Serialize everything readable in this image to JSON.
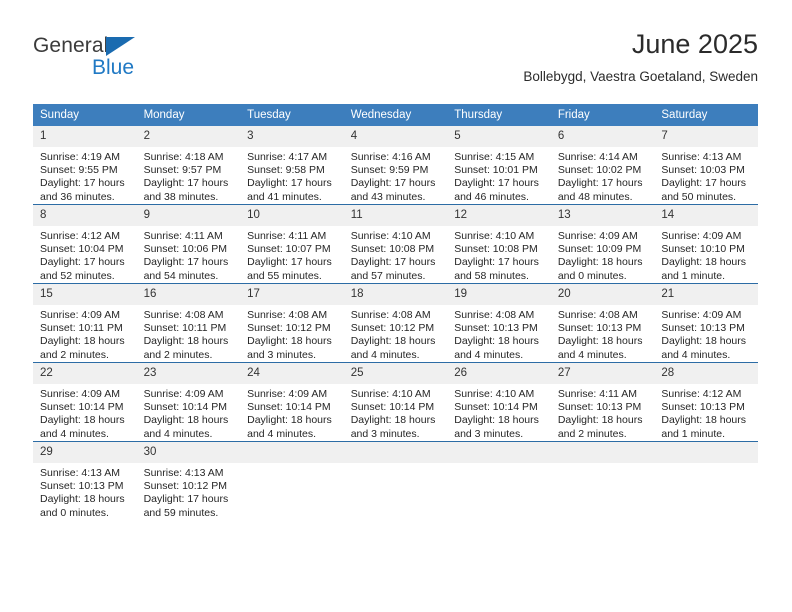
{
  "brand": {
    "name_top": "General",
    "name_bottom": "Blue",
    "accent_color": "#2079c4",
    "triangle_color": "#1a6bb0"
  },
  "header": {
    "title": "June 2025",
    "subtitle": "Bollebygd, Vaestra Goetaland, Sweden"
  },
  "theme": {
    "header_bg": "#3d7ebd",
    "row_divider": "#2c6ca5",
    "daynum_bg": "#f0f0f0"
  },
  "calendar": {
    "weekday_headers": [
      "Sunday",
      "Monday",
      "Tuesday",
      "Wednesday",
      "Thursday",
      "Friday",
      "Saturday"
    ],
    "weeks": [
      [
        {
          "day": "1",
          "sunrise": "Sunrise: 4:19 AM",
          "sunset": "Sunset: 9:55 PM",
          "daylight_line1": "Daylight: 17 hours",
          "daylight_line2": "and 36 minutes."
        },
        {
          "day": "2",
          "sunrise": "Sunrise: 4:18 AM",
          "sunset": "Sunset: 9:57 PM",
          "daylight_line1": "Daylight: 17 hours",
          "daylight_line2": "and 38 minutes."
        },
        {
          "day": "3",
          "sunrise": "Sunrise: 4:17 AM",
          "sunset": "Sunset: 9:58 PM",
          "daylight_line1": "Daylight: 17 hours",
          "daylight_line2": "and 41 minutes."
        },
        {
          "day": "4",
          "sunrise": "Sunrise: 4:16 AM",
          "sunset": "Sunset: 9:59 PM",
          "daylight_line1": "Daylight: 17 hours",
          "daylight_line2": "and 43 minutes."
        },
        {
          "day": "5",
          "sunrise": "Sunrise: 4:15 AM",
          "sunset": "Sunset: 10:01 PM",
          "daylight_line1": "Daylight: 17 hours",
          "daylight_line2": "and 46 minutes."
        },
        {
          "day": "6",
          "sunrise": "Sunrise: 4:14 AM",
          "sunset": "Sunset: 10:02 PM",
          "daylight_line1": "Daylight: 17 hours",
          "daylight_line2": "and 48 minutes."
        },
        {
          "day": "7",
          "sunrise": "Sunrise: 4:13 AM",
          "sunset": "Sunset: 10:03 PM",
          "daylight_line1": "Daylight: 17 hours",
          "daylight_line2": "and 50 minutes."
        }
      ],
      [
        {
          "day": "8",
          "sunrise": "Sunrise: 4:12 AM",
          "sunset": "Sunset: 10:04 PM",
          "daylight_line1": "Daylight: 17 hours",
          "daylight_line2": "and 52 minutes."
        },
        {
          "day": "9",
          "sunrise": "Sunrise: 4:11 AM",
          "sunset": "Sunset: 10:06 PM",
          "daylight_line1": "Daylight: 17 hours",
          "daylight_line2": "and 54 minutes."
        },
        {
          "day": "10",
          "sunrise": "Sunrise: 4:11 AM",
          "sunset": "Sunset: 10:07 PM",
          "daylight_line1": "Daylight: 17 hours",
          "daylight_line2": "and 55 minutes."
        },
        {
          "day": "11",
          "sunrise": "Sunrise: 4:10 AM",
          "sunset": "Sunset: 10:08 PM",
          "daylight_line1": "Daylight: 17 hours",
          "daylight_line2": "and 57 minutes."
        },
        {
          "day": "12",
          "sunrise": "Sunrise: 4:10 AM",
          "sunset": "Sunset: 10:08 PM",
          "daylight_line1": "Daylight: 17 hours",
          "daylight_line2": "and 58 minutes."
        },
        {
          "day": "13",
          "sunrise": "Sunrise: 4:09 AM",
          "sunset": "Sunset: 10:09 PM",
          "daylight_line1": "Daylight: 18 hours",
          "daylight_line2": "and 0 minutes."
        },
        {
          "day": "14",
          "sunrise": "Sunrise: 4:09 AM",
          "sunset": "Sunset: 10:10 PM",
          "daylight_line1": "Daylight: 18 hours",
          "daylight_line2": "and 1 minute."
        }
      ],
      [
        {
          "day": "15",
          "sunrise": "Sunrise: 4:09 AM",
          "sunset": "Sunset: 10:11 PM",
          "daylight_line1": "Daylight: 18 hours",
          "daylight_line2": "and 2 minutes."
        },
        {
          "day": "16",
          "sunrise": "Sunrise: 4:08 AM",
          "sunset": "Sunset: 10:11 PM",
          "daylight_line1": "Daylight: 18 hours",
          "daylight_line2": "and 2 minutes."
        },
        {
          "day": "17",
          "sunrise": "Sunrise: 4:08 AM",
          "sunset": "Sunset: 10:12 PM",
          "daylight_line1": "Daylight: 18 hours",
          "daylight_line2": "and 3 minutes."
        },
        {
          "day": "18",
          "sunrise": "Sunrise: 4:08 AM",
          "sunset": "Sunset: 10:12 PM",
          "daylight_line1": "Daylight: 18 hours",
          "daylight_line2": "and 4 minutes."
        },
        {
          "day": "19",
          "sunrise": "Sunrise: 4:08 AM",
          "sunset": "Sunset: 10:13 PM",
          "daylight_line1": "Daylight: 18 hours",
          "daylight_line2": "and 4 minutes."
        },
        {
          "day": "20",
          "sunrise": "Sunrise: 4:08 AM",
          "sunset": "Sunset: 10:13 PM",
          "daylight_line1": "Daylight: 18 hours",
          "daylight_line2": "and 4 minutes."
        },
        {
          "day": "21",
          "sunrise": "Sunrise: 4:09 AM",
          "sunset": "Sunset: 10:13 PM",
          "daylight_line1": "Daylight: 18 hours",
          "daylight_line2": "and 4 minutes."
        }
      ],
      [
        {
          "day": "22",
          "sunrise": "Sunrise: 4:09 AM",
          "sunset": "Sunset: 10:14 PM",
          "daylight_line1": "Daylight: 18 hours",
          "daylight_line2": "and 4 minutes."
        },
        {
          "day": "23",
          "sunrise": "Sunrise: 4:09 AM",
          "sunset": "Sunset: 10:14 PM",
          "daylight_line1": "Daylight: 18 hours",
          "daylight_line2": "and 4 minutes."
        },
        {
          "day": "24",
          "sunrise": "Sunrise: 4:09 AM",
          "sunset": "Sunset: 10:14 PM",
          "daylight_line1": "Daylight: 18 hours",
          "daylight_line2": "and 4 minutes."
        },
        {
          "day": "25",
          "sunrise": "Sunrise: 4:10 AM",
          "sunset": "Sunset: 10:14 PM",
          "daylight_line1": "Daylight: 18 hours",
          "daylight_line2": "and 3 minutes."
        },
        {
          "day": "26",
          "sunrise": "Sunrise: 4:10 AM",
          "sunset": "Sunset: 10:14 PM",
          "daylight_line1": "Daylight: 18 hours",
          "daylight_line2": "and 3 minutes."
        },
        {
          "day": "27",
          "sunrise": "Sunrise: 4:11 AM",
          "sunset": "Sunset: 10:13 PM",
          "daylight_line1": "Daylight: 18 hours",
          "daylight_line2": "and 2 minutes."
        },
        {
          "day": "28",
          "sunrise": "Sunrise: 4:12 AM",
          "sunset": "Sunset: 10:13 PM",
          "daylight_line1": "Daylight: 18 hours",
          "daylight_line2": "and 1 minute."
        }
      ],
      [
        {
          "day": "29",
          "sunrise": "Sunrise: 4:13 AM",
          "sunset": "Sunset: 10:13 PM",
          "daylight_line1": "Daylight: 18 hours",
          "daylight_line2": "and 0 minutes."
        },
        {
          "day": "30",
          "sunrise": "Sunrise: 4:13 AM",
          "sunset": "Sunset: 10:12 PM",
          "daylight_line1": "Daylight: 17 hours",
          "daylight_line2": "and 59 minutes."
        },
        {
          "day": "",
          "sunrise": "",
          "sunset": "",
          "daylight_line1": "",
          "daylight_line2": ""
        },
        {
          "day": "",
          "sunrise": "",
          "sunset": "",
          "daylight_line1": "",
          "daylight_line2": ""
        },
        {
          "day": "",
          "sunrise": "",
          "sunset": "",
          "daylight_line1": "",
          "daylight_line2": ""
        },
        {
          "day": "",
          "sunrise": "",
          "sunset": "",
          "daylight_line1": "",
          "daylight_line2": ""
        },
        {
          "day": "",
          "sunrise": "",
          "sunset": "",
          "daylight_line1": "",
          "daylight_line2": ""
        }
      ]
    ]
  }
}
